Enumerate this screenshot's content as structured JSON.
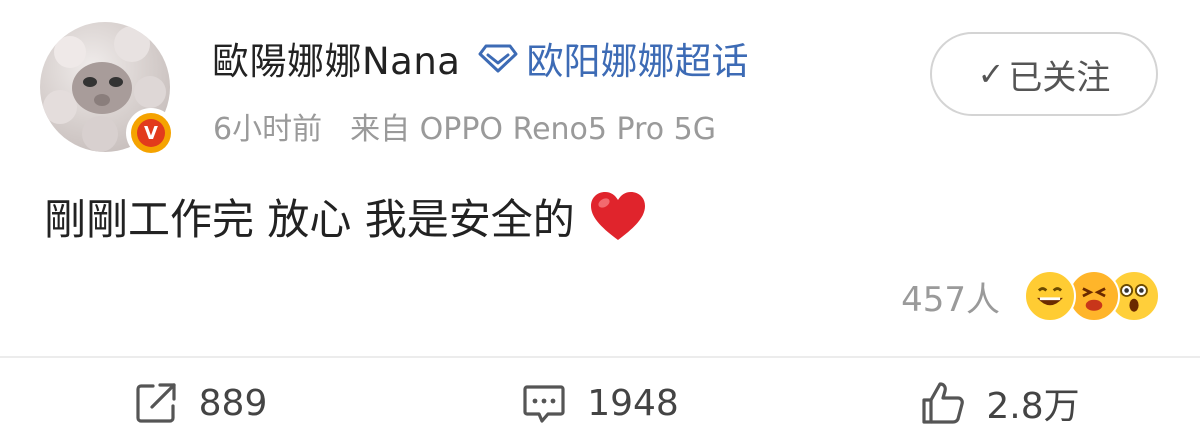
{
  "post": {
    "user_name": "歐陽娜娜Nana",
    "topic_label": "欧阳娜娜超话",
    "time": "6小时前",
    "source": "来自 OPPO Reno5 Pro 5G",
    "follow_label": "已关注",
    "content": "剛剛工作完 放心 我是安全的",
    "reaction_count": "457人"
  },
  "actions": {
    "share_count": "889",
    "comment_count": "1948",
    "like_count": "2.8万"
  },
  "colors": {
    "topic_blue": "#3d6bb5",
    "meta_gray": "#9a9a9a",
    "heart_red": "#e0242c"
  },
  "icons": [
    "avatar",
    "verified-v-badge",
    "diamond-icon",
    "check-icon",
    "heart-icon",
    "emoji-laugh-icon",
    "emoji-wince-icon",
    "emoji-shock-icon",
    "share-icon",
    "comment-icon",
    "like-icon"
  ]
}
